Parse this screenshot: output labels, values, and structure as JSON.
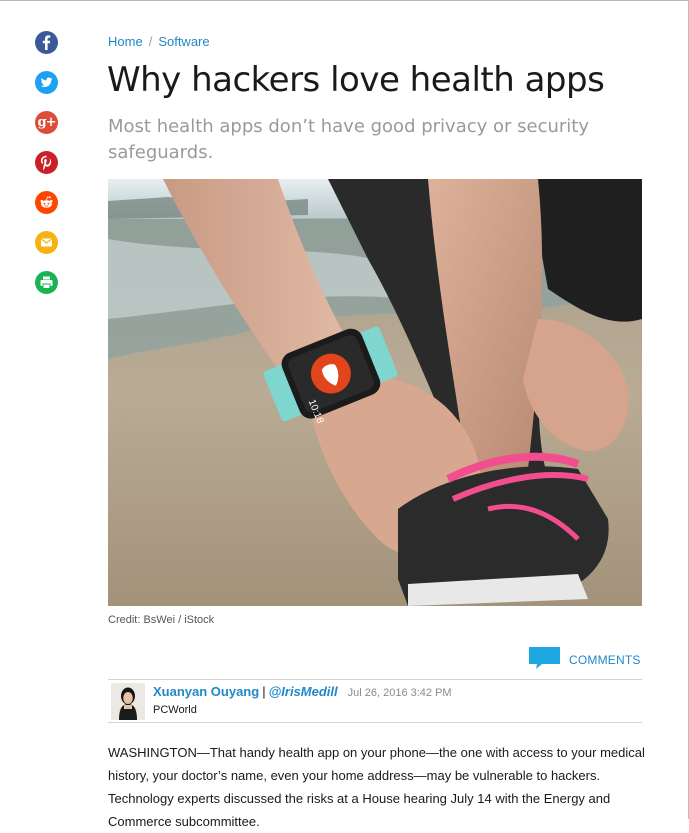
{
  "share": {
    "items": [
      {
        "name": "facebook",
        "color": "#3b5998"
      },
      {
        "name": "twitter",
        "color": "#1da1f2"
      },
      {
        "name": "google-plus",
        "color": "#dd4b39"
      },
      {
        "name": "pinterest",
        "color": "#cb2027"
      },
      {
        "name": "reddit",
        "color": "#ff4500"
      },
      {
        "name": "email",
        "color": "#f5b312"
      },
      {
        "name": "print",
        "color": "#1ab354"
      }
    ]
  },
  "breadcrumb": {
    "home": "Home",
    "separator": "/",
    "category": "Software"
  },
  "article": {
    "headline": "Why hackers love health apps",
    "dek": "Most health apps don’t have good privacy or security safeguards.",
    "image_credit": "Credit: BsWei / iStock",
    "watch_time": "10:18",
    "comments_label": "COMMENTS",
    "author": "Xuanyan Ouyang",
    "byline_separator": "|",
    "handle": "@IrisMedill",
    "date": "Jul 26, 2016 3:42 PM",
    "publication": "PCWorld",
    "body": "WASHINGTON—That handy health app on your phone—the one with access to your medical history, your doctor’s name, even your home address—may be vulnerable to hackers. Technology experts discussed the risks at a House hearing July 14 with the Energy and Commerce subcommittee."
  },
  "colors": {
    "link": "#1e88c9",
    "comments_bubble": "#1ea7e0"
  }
}
